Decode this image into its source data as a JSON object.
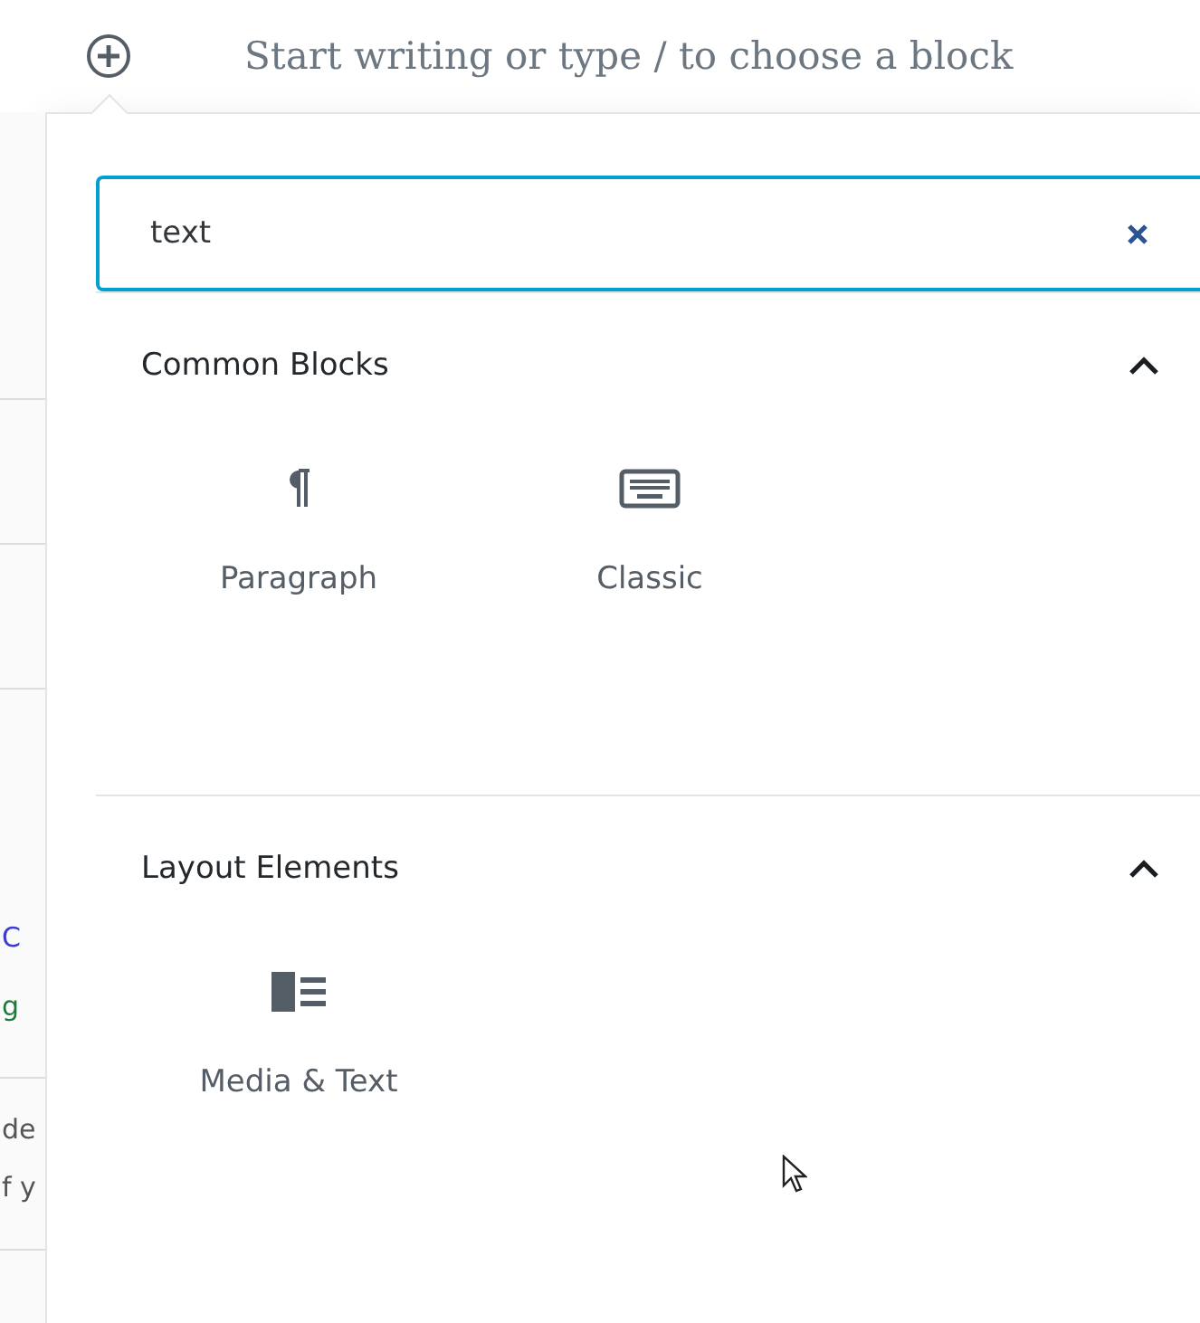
{
  "editor": {
    "placeholder": "Start writing or type / to choose a block"
  },
  "background_fragments": [
    {
      "text": "C",
      "color": "#3c3cd0"
    },
    {
      "text": "g",
      "color": "#1e7a3a"
    },
    {
      "text": "de",
      "color": "#555555"
    },
    {
      "text": "f y",
      "color": "#555555"
    }
  ],
  "inserter": {
    "search": {
      "value": "text"
    },
    "sections": [
      {
        "title": "Common Blocks",
        "expanded": true,
        "blocks": [
          {
            "label": "Paragraph",
            "kind": "paragraph"
          },
          {
            "label": "Classic",
            "kind": "keyboard"
          }
        ]
      },
      {
        "title": "Layout Elements",
        "expanded": true,
        "blocks": [
          {
            "label": "Media & Text",
            "kind": "media-text"
          }
        ]
      }
    ]
  }
}
